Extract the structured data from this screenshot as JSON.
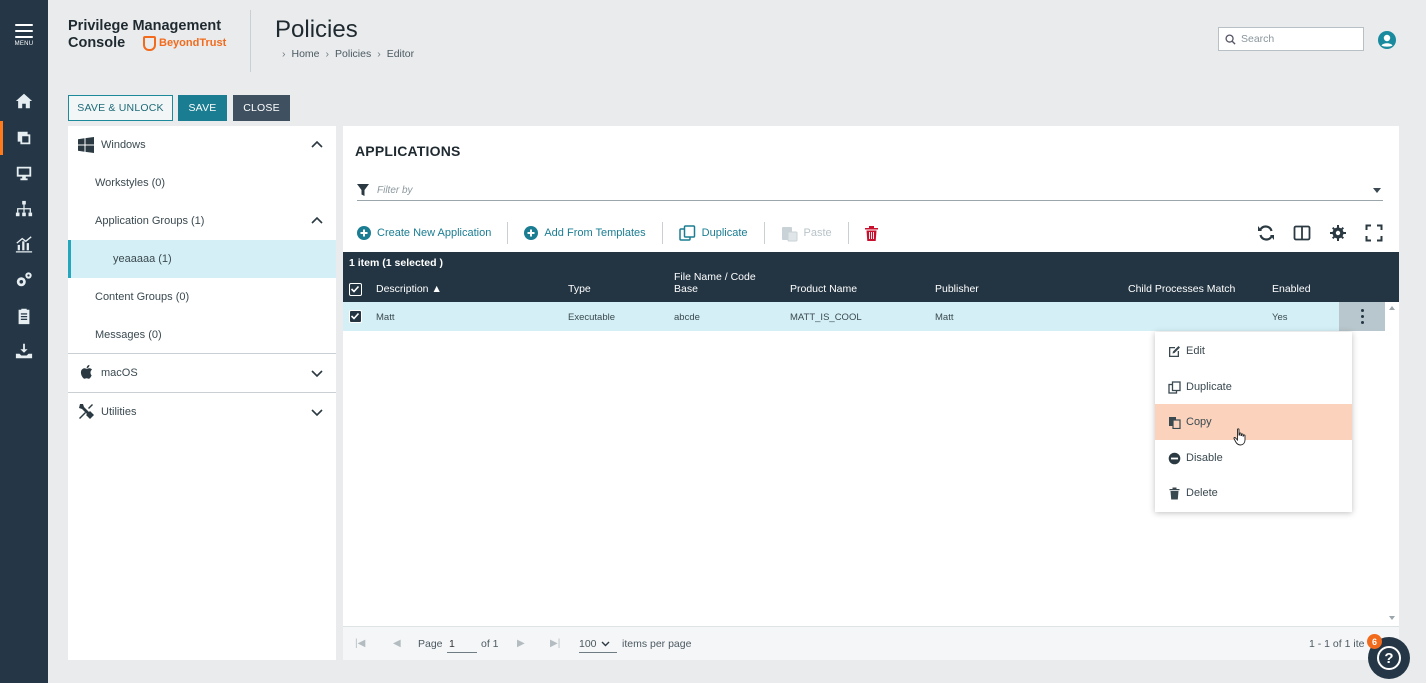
{
  "rail": {
    "menu_label": "MENU",
    "icons": [
      "home-icon",
      "policies-icon",
      "computers-icon",
      "groups-icon",
      "analytics-icon",
      "configuration-icon",
      "clipboard-icon",
      "deploy-icon"
    ],
    "accent": "#ff7a1a"
  },
  "header": {
    "brand_line1": "Privilege Management",
    "brand_line2": "Console",
    "brand_vendor": "BeyondTrust",
    "page_title": "Policies",
    "breadcrumb": [
      "Home",
      "Policies",
      "Editor"
    ],
    "search_placeholder": "Search"
  },
  "toolbar": {
    "save_unlock_label": "SAVE & UNLOCK",
    "save_label": "SAVE",
    "close_label": "CLOSE"
  },
  "tree": {
    "windows_label": "Windows",
    "workstyles_label": "Workstyles (0)",
    "app_groups_label": "Application Groups (1)",
    "selected_group_label": "yeaaaaa (1)",
    "content_groups_label": "Content Groups (0)",
    "messages_label": "Messages (0)",
    "macos_label": "macOS",
    "utilities_label": "Utilities"
  },
  "main": {
    "title": "APPLICATIONS",
    "filter_placeholder": "Filter by",
    "actions": {
      "create": "Create New Application",
      "templates": "Add From Templates",
      "duplicate": "Duplicate",
      "paste": "Paste"
    },
    "grid": {
      "count_text": "1 item (1 selected )",
      "columns": {
        "description": "Description ▲",
        "type": "Type",
        "file_line1": "File Name / Code",
        "file_line2": "Base",
        "product": "Product Name",
        "publisher": "Publisher",
        "child": "Child Processes Match",
        "enabled": "Enabled"
      },
      "row": {
        "description": "Matt",
        "type": "Executable",
        "file": "abcde",
        "product": "MATT_IS_COOL",
        "publisher": "Matt",
        "child": "",
        "enabled": "Yes"
      }
    },
    "pager": {
      "page_label": "Page",
      "page_value": "1",
      "of_label": "of 1",
      "per_page_value": "100",
      "per_page_label": "items per page",
      "summary": "1 - 1 of 1 ite"
    }
  },
  "context_menu": {
    "items": [
      "Edit",
      "Duplicate",
      "Copy",
      "Disable",
      "Delete"
    ]
  },
  "help": {
    "badge": "6"
  },
  "colors": {
    "rail": "#253746",
    "teal": "#1a7d92",
    "grid_header": "#233543",
    "selection": "#d4f0f6",
    "menu_highlight": "#fbd3bd",
    "delete_red": "#c8102e"
  }
}
